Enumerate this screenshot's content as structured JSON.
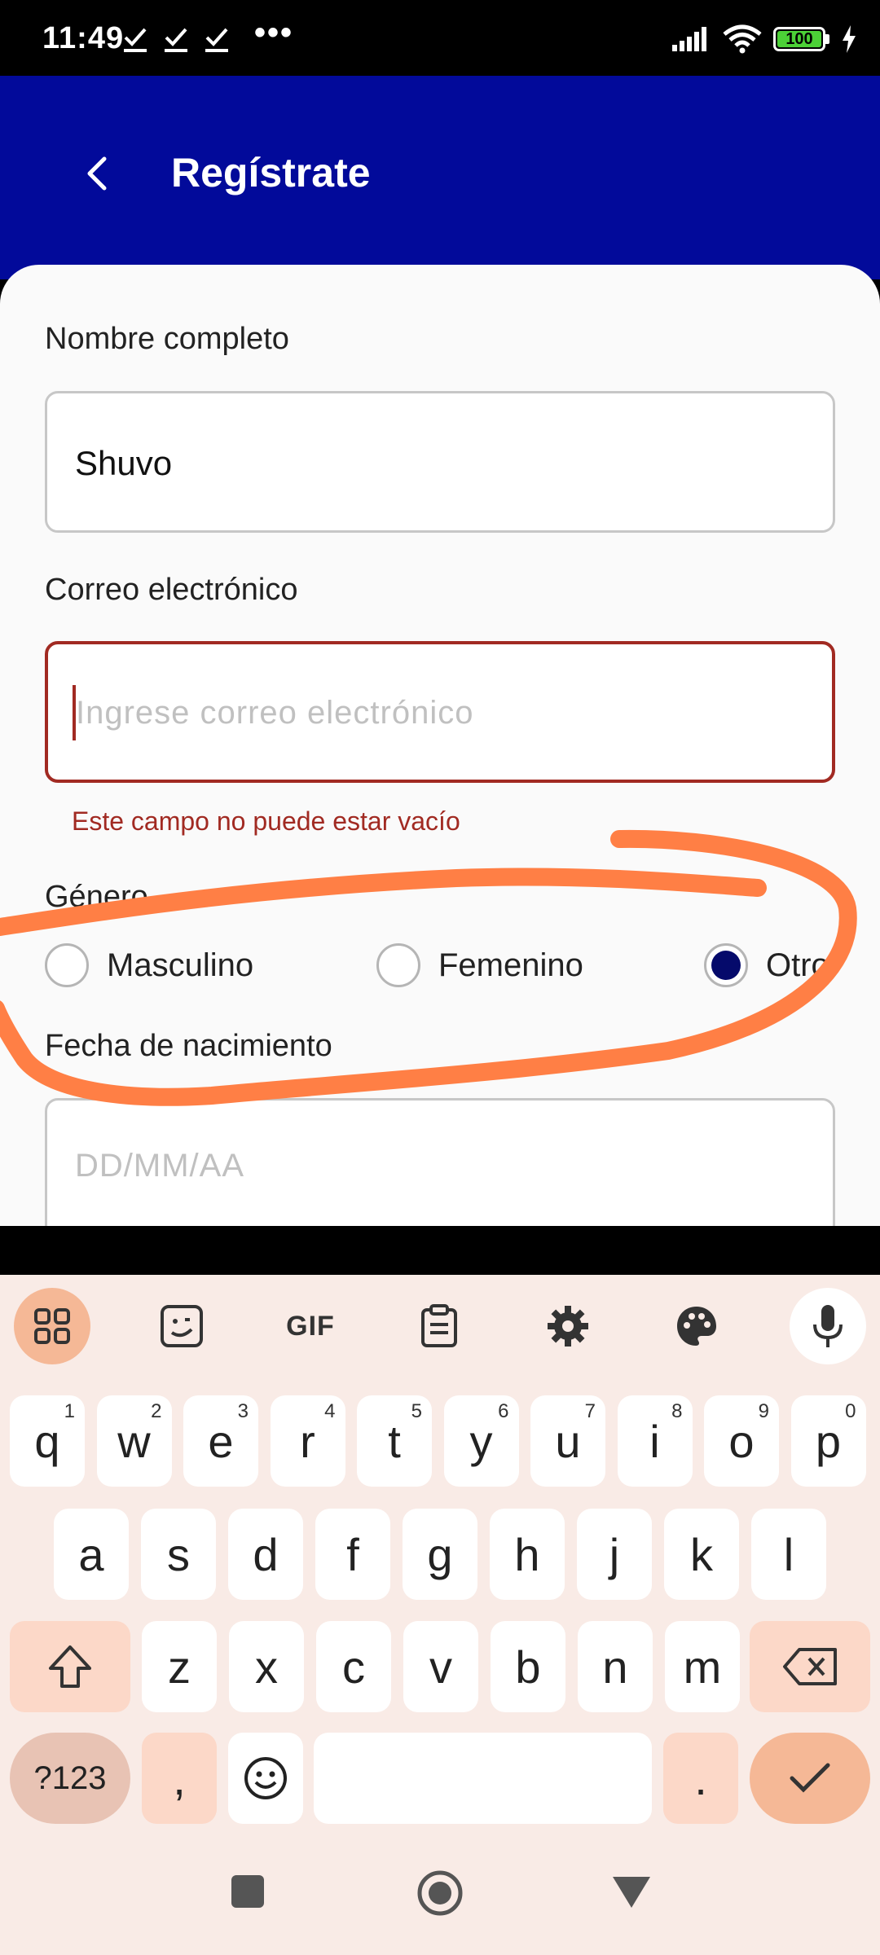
{
  "status_bar": {
    "time": "11:49",
    "dots": "•••",
    "battery": "100"
  },
  "app_bar": {
    "title": "Regístrate"
  },
  "form": {
    "name_label": "Nombre completo",
    "name_value": "Shuvo",
    "email_label": "Correo electrónico",
    "email_placeholder": "Ingrese correo electrónico",
    "email_error": "Este campo no puede estar vacío",
    "gender_label": "Género",
    "gender_options": [
      "Masculino",
      "Femenino",
      "Otro"
    ],
    "gender_selected": "Otro",
    "dob_label": "Fecha de nacimiento",
    "dob_placeholder": "DD/MM/AA"
  },
  "keyboard": {
    "toolbar": {
      "gif_label": "GIF"
    },
    "row1": [
      {
        "key": "q",
        "hint": "1"
      },
      {
        "key": "w",
        "hint": "2"
      },
      {
        "key": "e",
        "hint": "3"
      },
      {
        "key": "r",
        "hint": "4"
      },
      {
        "key": "t",
        "hint": "5"
      },
      {
        "key": "y",
        "hint": "6"
      },
      {
        "key": "u",
        "hint": "7"
      },
      {
        "key": "i",
        "hint": "8"
      },
      {
        "key": "o",
        "hint": "9"
      },
      {
        "key": "p",
        "hint": "0"
      }
    ],
    "row2": [
      "a",
      "s",
      "d",
      "f",
      "g",
      "h",
      "j",
      "k",
      "l"
    ],
    "row3": [
      "z",
      "x",
      "c",
      "v",
      "b",
      "n",
      "m"
    ],
    "symbols_label": "?123",
    "comma_label": ",",
    "period_label": "."
  },
  "colors": {
    "app_bar": "#020a9a",
    "error": "#a12a22",
    "radio_selected": "#050a6b",
    "annotation_stroke": "#ff7f45",
    "keyboard_bg": "#f9ebe6",
    "keyboard_accent": "#f5b896"
  }
}
